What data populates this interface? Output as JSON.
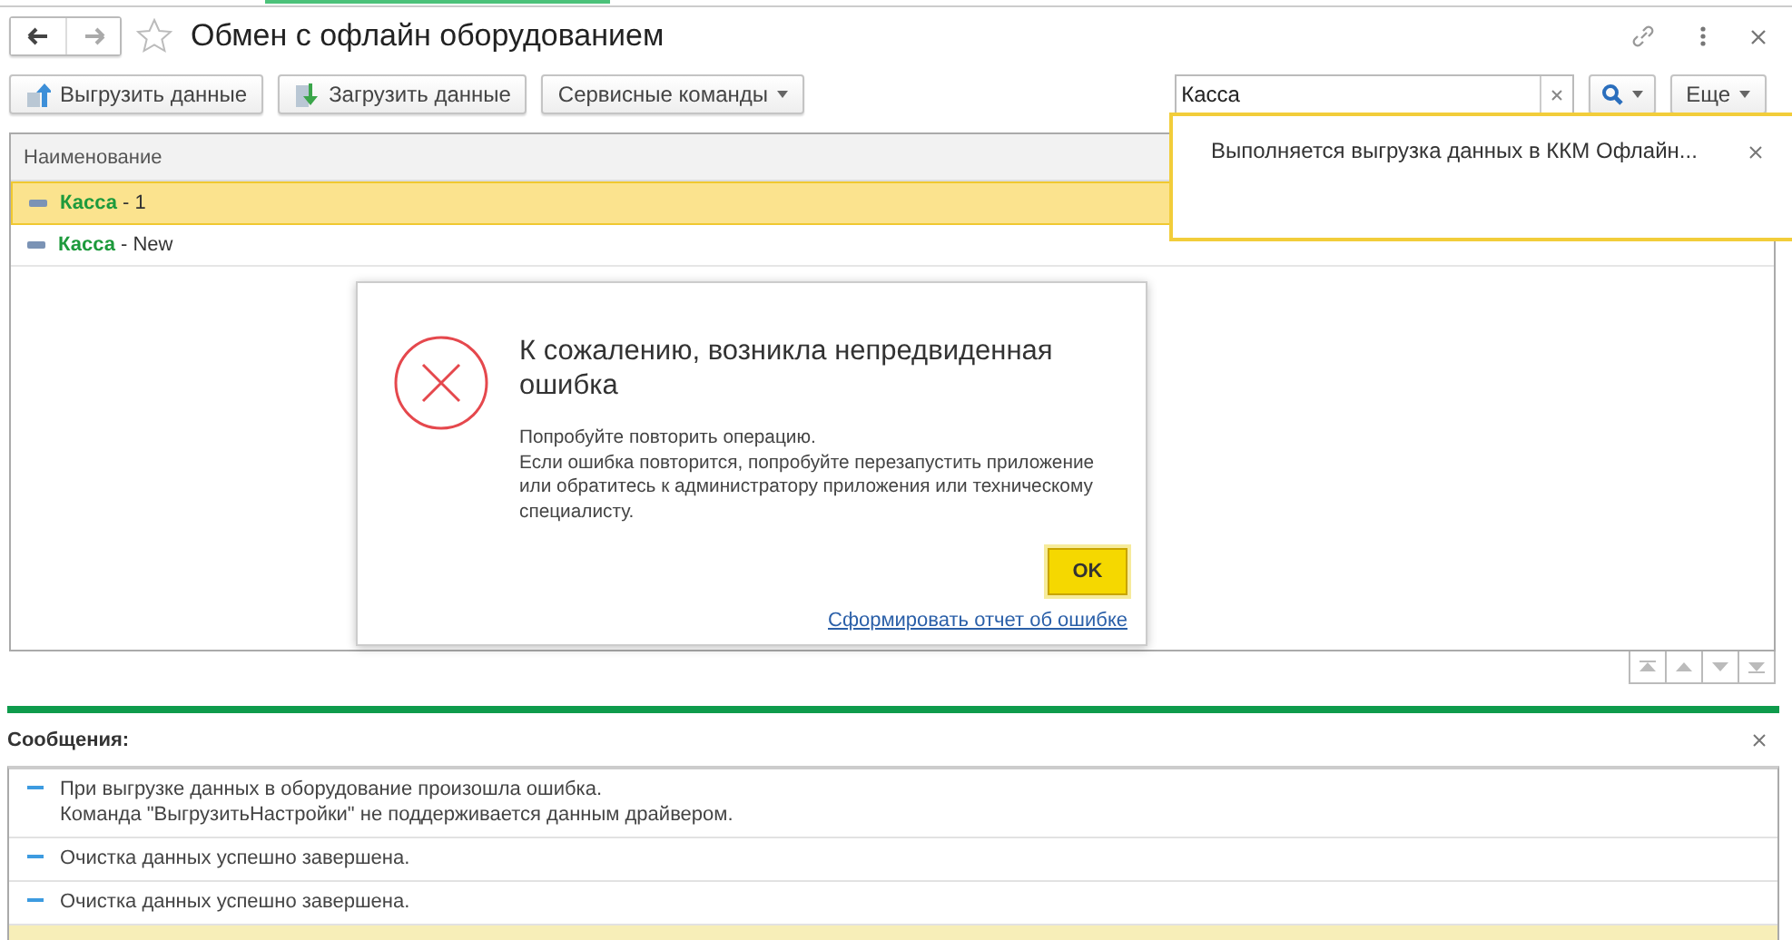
{
  "window": {
    "title": "Обмен с офлайн оборудованием",
    "favorite": false
  },
  "toolbar": {
    "buttons": [
      {
        "label": "Выгрузить данные",
        "kind": "upload"
      },
      {
        "label": "Загрузить данные",
        "kind": "download"
      },
      {
        "label": "Сервисные команды",
        "kind": "menu"
      }
    ],
    "search": {
      "value": "Касса"
    },
    "more": "Еще"
  },
  "table": {
    "columns": [
      "Наименование"
    ],
    "rows": [
      {
        "match": "Касса",
        "rest": " - 1",
        "selected": true
      },
      {
        "match": "Касса",
        "rest": " - New",
        "selected": false
      }
    ]
  },
  "notification": {
    "text": "Выполняется выгрузка данных в ККМ Офлайн..."
  },
  "dialog": {
    "title": "К сожалению, возникла непредвиденная ошибка",
    "message": [
      "Попробуйте повторить операцию.",
      "Если ошибка повторится, попробуйте перезапустить приложение или обратитесь к администратору приложения или техническому специалисту."
    ],
    "ok": "OK",
    "link": "Сформировать отчет об ошибке"
  },
  "messages": {
    "title": "Сообщения:",
    "items": [
      {
        "lines": [
          "При выгрузке данных в оборудование произошла ошибка.",
          "Команда \"ВыгрузитьНастройки\" не поддерживается данным драйвером."
        ]
      },
      {
        "lines": [
          "Очистка данных успешно завершена."
        ]
      },
      {
        "lines": [
          "Очистка данных успешно завершена."
        ]
      }
    ]
  }
}
